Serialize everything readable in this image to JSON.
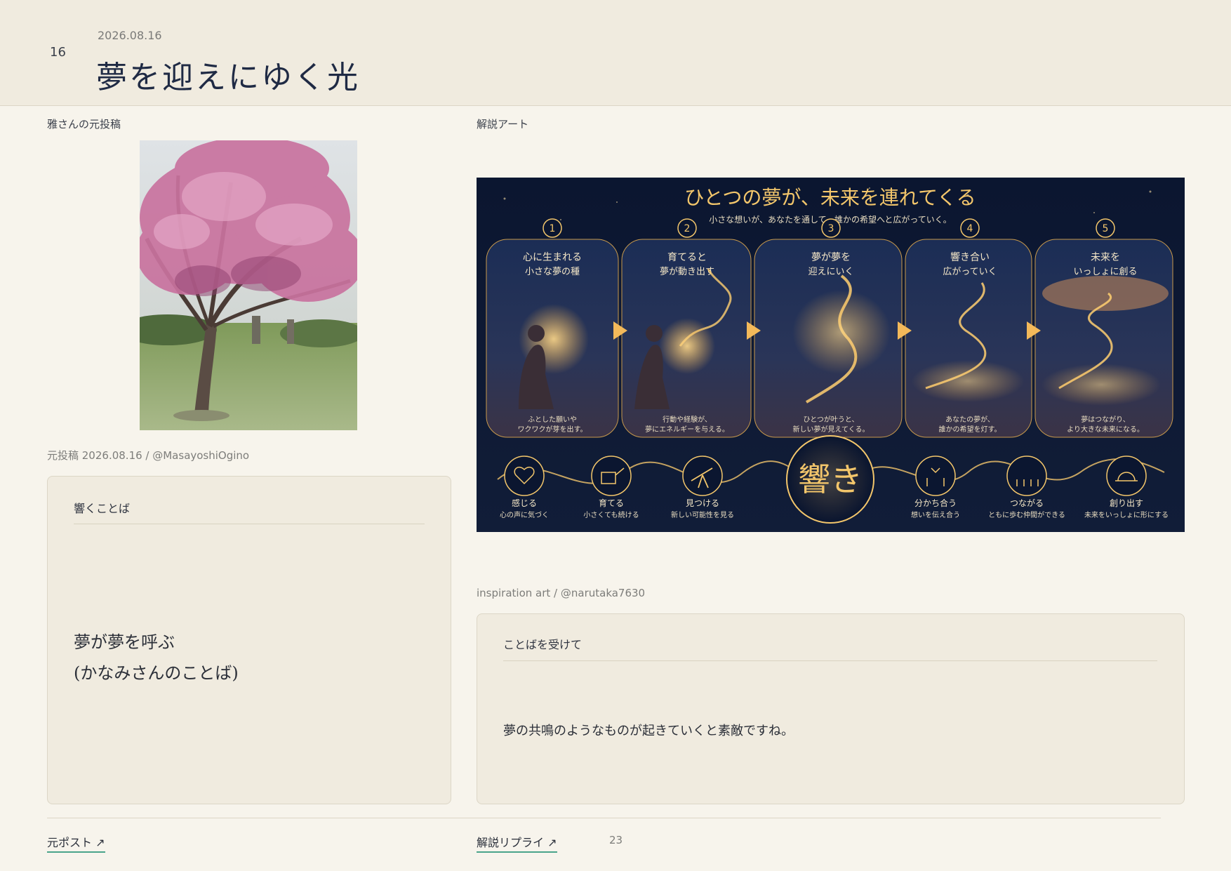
{
  "header": {
    "page_number": "16",
    "date": "2026.08.16",
    "title": "夢を迎えにゆく光"
  },
  "left": {
    "label": "雅さんの元投稿",
    "photo_caption": "元投稿 2026.08.16 / @MasayoshiOgino",
    "card": {
      "heading": "響くことば",
      "quote": "夢が夢を呼ぶ\n(かなみさんのことば)"
    }
  },
  "right": {
    "label": "解説アート",
    "art_caption": "inspiration art / @narutaka7630",
    "card": {
      "heading": "ことばを受けて",
      "comment": "夢の共鳴のようなものが起きていくと素敵ですね。"
    }
  },
  "art": {
    "title": "ひとつの夢が、未来を連れてくる",
    "subtitle": "小さな想いが、あなたを通して、誰かの希望へと広がっていく。",
    "panels": [
      {
        "num": "1",
        "head1": "心に生まれる",
        "head2": "小さな夢の種",
        "foot1": "ふとした願いや",
        "foot2": "ワクワクが芽を出す。"
      },
      {
        "num": "2",
        "head1": "育てると",
        "head2": "夢が動き出す",
        "foot1": "行動や経験が、",
        "foot2": "夢にエネルギーを与える。"
      },
      {
        "num": "3",
        "head1": "夢が夢を",
        "head2": "迎えにいく",
        "foot1": "ひとつが叶うと、",
        "foot2": "新しい夢が見えてくる。"
      },
      {
        "num": "4",
        "head1": "響き合い",
        "head2": "広がっていく",
        "foot1": "あなたの夢が、",
        "foot2": "誰かの希望を灯す。"
      },
      {
        "num": "5",
        "head1": "未来を",
        "head2": "いっしょに創る",
        "foot1": "夢はつながり、",
        "foot2": "より大きな未来になる。"
      }
    ],
    "center_word": "響き",
    "icons": [
      {
        "label": "感じる",
        "sub": "心の声に気づく",
        "icon": "heart-icon"
      },
      {
        "label": "育てる",
        "sub": "小さくても続ける",
        "icon": "watering-can-icon"
      },
      {
        "label": "見つける",
        "sub": "新しい可能性を見る",
        "icon": "telescope-icon"
      },
      {
        "label": "分かち合う",
        "sub": "想いを伝え合う",
        "icon": "people-heart-icon"
      },
      {
        "label": "つながる",
        "sub": "ともに歩む仲間ができる",
        "icon": "group-icon"
      },
      {
        "label": "創り出す",
        "sub": "未来をいっしょに形にする",
        "icon": "sunrise-icon"
      }
    ]
  },
  "footer": {
    "left_link": "元ポスト ↗",
    "right_link": "解説リプライ ↗",
    "page_number": "23"
  },
  "colors": {
    "background": "#f7f4ec",
    "header_bg": "#f0ebdf",
    "title": "#1f2a44",
    "link_underline": "#4aa48b",
    "art_gold": "#f3c66b",
    "art_navy": "#0e1a33"
  }
}
